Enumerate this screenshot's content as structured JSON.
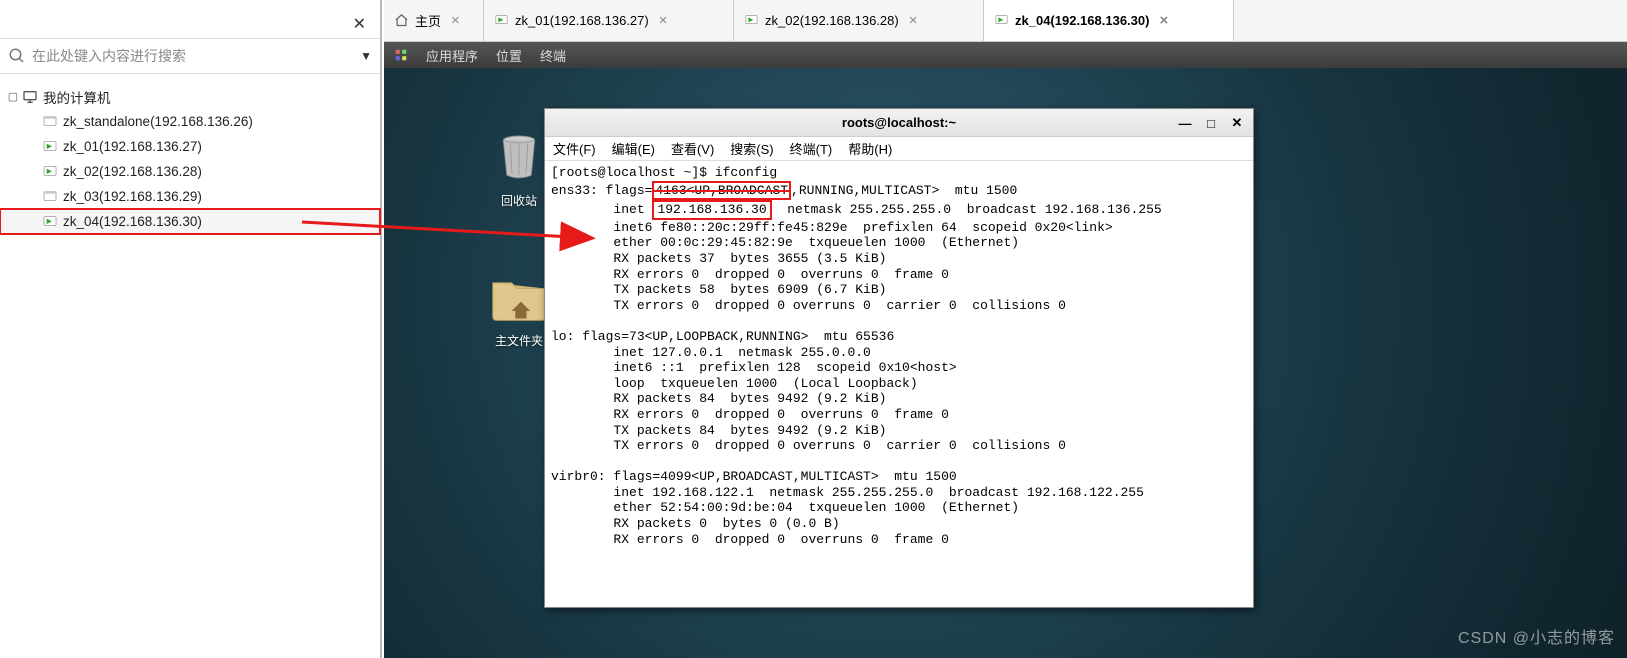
{
  "sidebar": {
    "search_placeholder": "在此处键入内容进行搜索",
    "root_label": "我的计算机",
    "items": [
      {
        "label": "zk_standalone(192.168.136.26)"
      },
      {
        "label": "zk_01(192.168.136.27)"
      },
      {
        "label": "zk_02(192.168.136.28)"
      },
      {
        "label": "zk_03(192.168.136.29)"
      },
      {
        "label": "zk_04(192.168.136.30)"
      }
    ],
    "selected_index": 4
  },
  "tabs": {
    "home_label": "主页",
    "items": [
      {
        "label": "zk_01(192.168.136.27)"
      },
      {
        "label": "zk_02(192.168.136.28)"
      },
      {
        "label": "zk_04(192.168.136.30)",
        "active": true
      }
    ]
  },
  "gnome": {
    "apps": "应用程序",
    "places": "位置",
    "terminal": "终端"
  },
  "desktop": {
    "trash_label": "回收站",
    "home_label": "主文件夹"
  },
  "terminal": {
    "title": "roots@localhost:~",
    "menu": {
      "file": "文件(F)",
      "edit": "编辑(E)",
      "view": "查看(V)",
      "search": "搜索(S)",
      "term": "终端(T)",
      "help": "帮助(H)"
    },
    "prompt": "[roots@localhost ~]$ ifconfig",
    "highlight_ip": "192.168.136.30",
    "lines": {
      "l1a": "ens33: flags=",
      "l1b": "4163<UP,BROADCAST",
      "l1c": ",RUNNING,MULTICAST>  mtu 1500",
      "l2a": "        inet",
      "l2c": "  netmask 255.255.255.0  broadcast 192.168.136.255",
      "l3": "        inet6 fe80::20c:29ff:fe45:829e  prefixlen 64  scopeid 0x20<link>",
      "l4": "        ether 00:0c:29:45:82:9e  txqueuelen 1000  (Ethernet)",
      "l5": "        RX packets 37  bytes 3655 (3.5 KiB)",
      "l6": "        RX errors 0  dropped 0  overruns 0  frame 0",
      "l7": "        TX packets 58  bytes 6909 (6.7 KiB)",
      "l8": "        TX errors 0  dropped 0 overruns 0  carrier 0  collisions 0",
      "bl1": " ",
      "l9": "lo: flags=73<UP,LOOPBACK,RUNNING>  mtu 65536",
      "l10": "        inet 127.0.0.1  netmask 255.0.0.0",
      "l11": "        inet6 ::1  prefixlen 128  scopeid 0x10<host>",
      "l12": "        loop  txqueuelen 1000  (Local Loopback)",
      "l13": "        RX packets 84  bytes 9492 (9.2 KiB)",
      "l14": "        RX errors 0  dropped 0  overruns 0  frame 0",
      "l15": "        TX packets 84  bytes 9492 (9.2 KiB)",
      "l16": "        TX errors 0  dropped 0 overruns 0  carrier 0  collisions 0",
      "bl2": " ",
      "l17": "virbr0: flags=4099<UP,BROADCAST,MULTICAST>  mtu 1500",
      "l18": "        inet 192.168.122.1  netmask 255.255.255.0  broadcast 192.168.122.255",
      "l19": "        ether 52:54:00:9d:be:04  txqueuelen 1000  (Ethernet)",
      "l20": "        RX packets 0  bytes 0 (0.0 B)",
      "l21": "        RX errors 0  dropped 0  overruns 0  frame 0"
    }
  },
  "watermark": "CSDN @小志的博客"
}
